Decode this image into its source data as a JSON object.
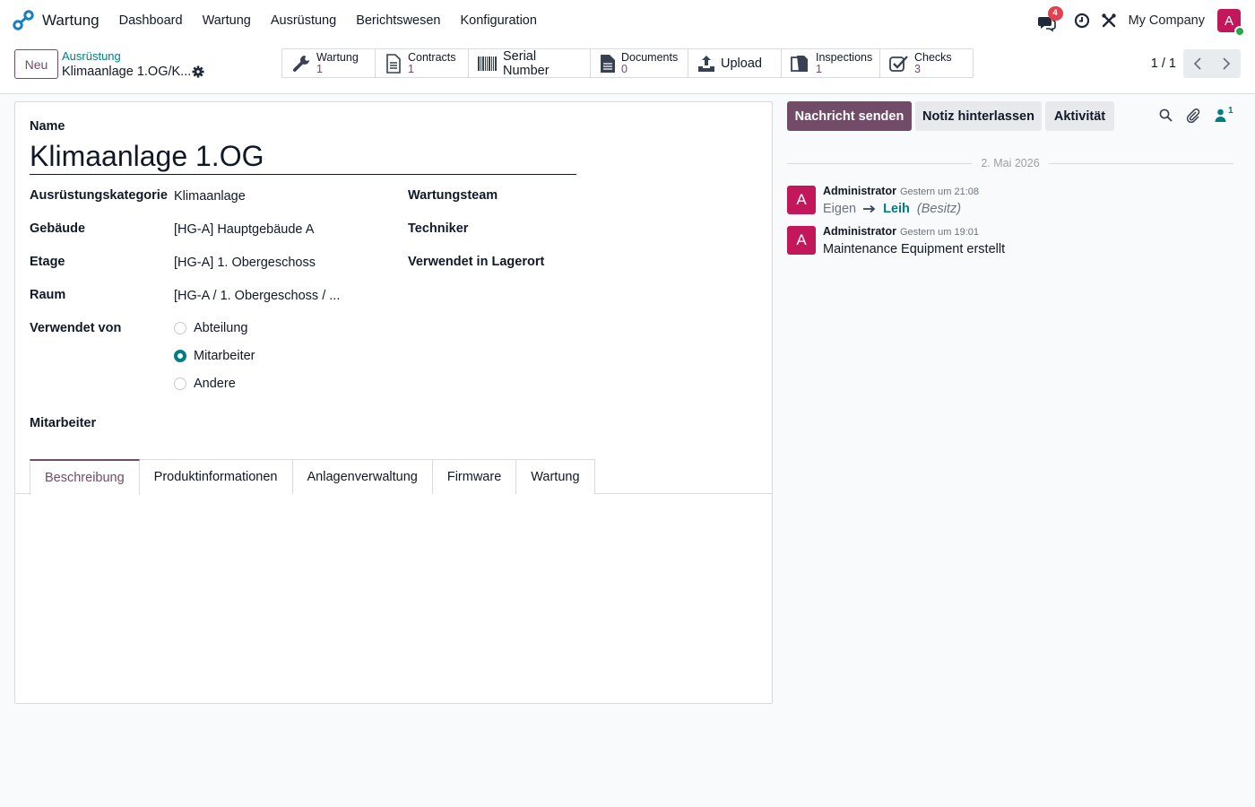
{
  "app": {
    "name": "Wartung"
  },
  "nav": {
    "menu": [
      "Dashboard",
      "Wartung",
      "Ausrüstung",
      "Berichtswesen",
      "Konfiguration"
    ],
    "message_badge": "4",
    "company": "My Company",
    "user_initial": "A"
  },
  "control": {
    "new_label": "Neu",
    "breadcrumb_parent": "Ausrüstung",
    "breadcrumb_current": "Klimaanlage 1.OG/K...",
    "smart_buttons": [
      {
        "label": "Wartung",
        "count": "1",
        "icon": "wrench-icon"
      },
      {
        "label": "Contracts",
        "count": "1",
        "icon": "document-icon"
      },
      {
        "label": "Serial Number",
        "icon": "barcode-icon"
      },
      {
        "label": "Documents",
        "count": "0",
        "icon": "file-icon"
      },
      {
        "label": "Upload",
        "icon": "upload-icon"
      },
      {
        "label": "Inspections",
        "count": "1",
        "icon": "copy-icon"
      },
      {
        "label": "Checks",
        "count": "3",
        "icon": "check-square-icon"
      }
    ],
    "pager": "1 / 1"
  },
  "form": {
    "name_label": "Name",
    "name_value": "Klimaanlage 1.OG",
    "fields_left": [
      {
        "label": "Ausrüstungskategorie",
        "value": "Klimaanlage"
      },
      {
        "label": "Gebäude",
        "value": "[HG-A] Hauptgebäude A"
      },
      {
        "label": "Etage",
        "value": "[HG-A] 1. Obergeschoss"
      },
      {
        "label": "Raum",
        "value": "[HG-A / 1. Obergeschoss / ..."
      }
    ],
    "fields_right": [
      {
        "label": "Wartungsteam"
      },
      {
        "label": "Techniker"
      },
      {
        "label": "Verwendet in Lagerort"
      }
    ],
    "used_by_label": "Verwendet von",
    "used_by_options": [
      "Abteilung",
      "Mitarbeiter",
      "Andere"
    ],
    "used_by_selected": "Mitarbeiter",
    "employee_label": "Mitarbeiter",
    "tabs": [
      "Beschreibung",
      "Produktinformationen",
      "Anlagenverwaltung",
      "Firmware",
      "Wartung"
    ],
    "active_tab": "Beschreibung"
  },
  "chatter": {
    "send_label": "Nachricht senden",
    "note_label": "Notiz hinterlassen",
    "activity_label": "Aktivität",
    "follower_count": "1",
    "date_separator": "2. Mai 2026",
    "messages": [
      {
        "author": "Administrator",
        "date": "Gestern um 21:08",
        "initial": "A",
        "old_value": "Eigen",
        "new_value": "Leih",
        "field": "(Besitz)"
      },
      {
        "author": "Administrator",
        "date": "Gestern um 19:01",
        "initial": "A",
        "body": "Maintenance Equipment erstellt"
      }
    ]
  },
  "colors": {
    "primary": "#714b67",
    "teal": "#017e84",
    "avatar": "#c2185b",
    "badge": "#e3414f"
  }
}
